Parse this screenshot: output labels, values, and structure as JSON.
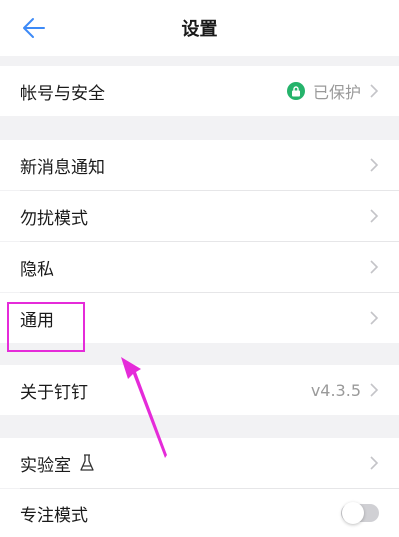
{
  "header": {
    "title": "设置"
  },
  "rows": {
    "account": {
      "label": "帐号与安全",
      "status": "已保护"
    },
    "notify": {
      "label": "新消息通知"
    },
    "dnd": {
      "label": "勿扰模式"
    },
    "privacy": {
      "label": "隐私"
    },
    "general": {
      "label": "通用"
    },
    "about": {
      "label": "关于钉钉",
      "version": "v4.3.5"
    },
    "lab": {
      "label": "实验室"
    },
    "focus": {
      "label": "专注模式",
      "enabled": false
    }
  },
  "colors": {
    "accent_blue": "#3d8af7",
    "secure_green": "#25b36b",
    "annotation_magenta": "#e52bd9"
  },
  "icons": {
    "back": "arrow-left-icon",
    "lock": "lock-icon",
    "chevron": "chevron-right-icon",
    "flask": "flask-icon"
  }
}
